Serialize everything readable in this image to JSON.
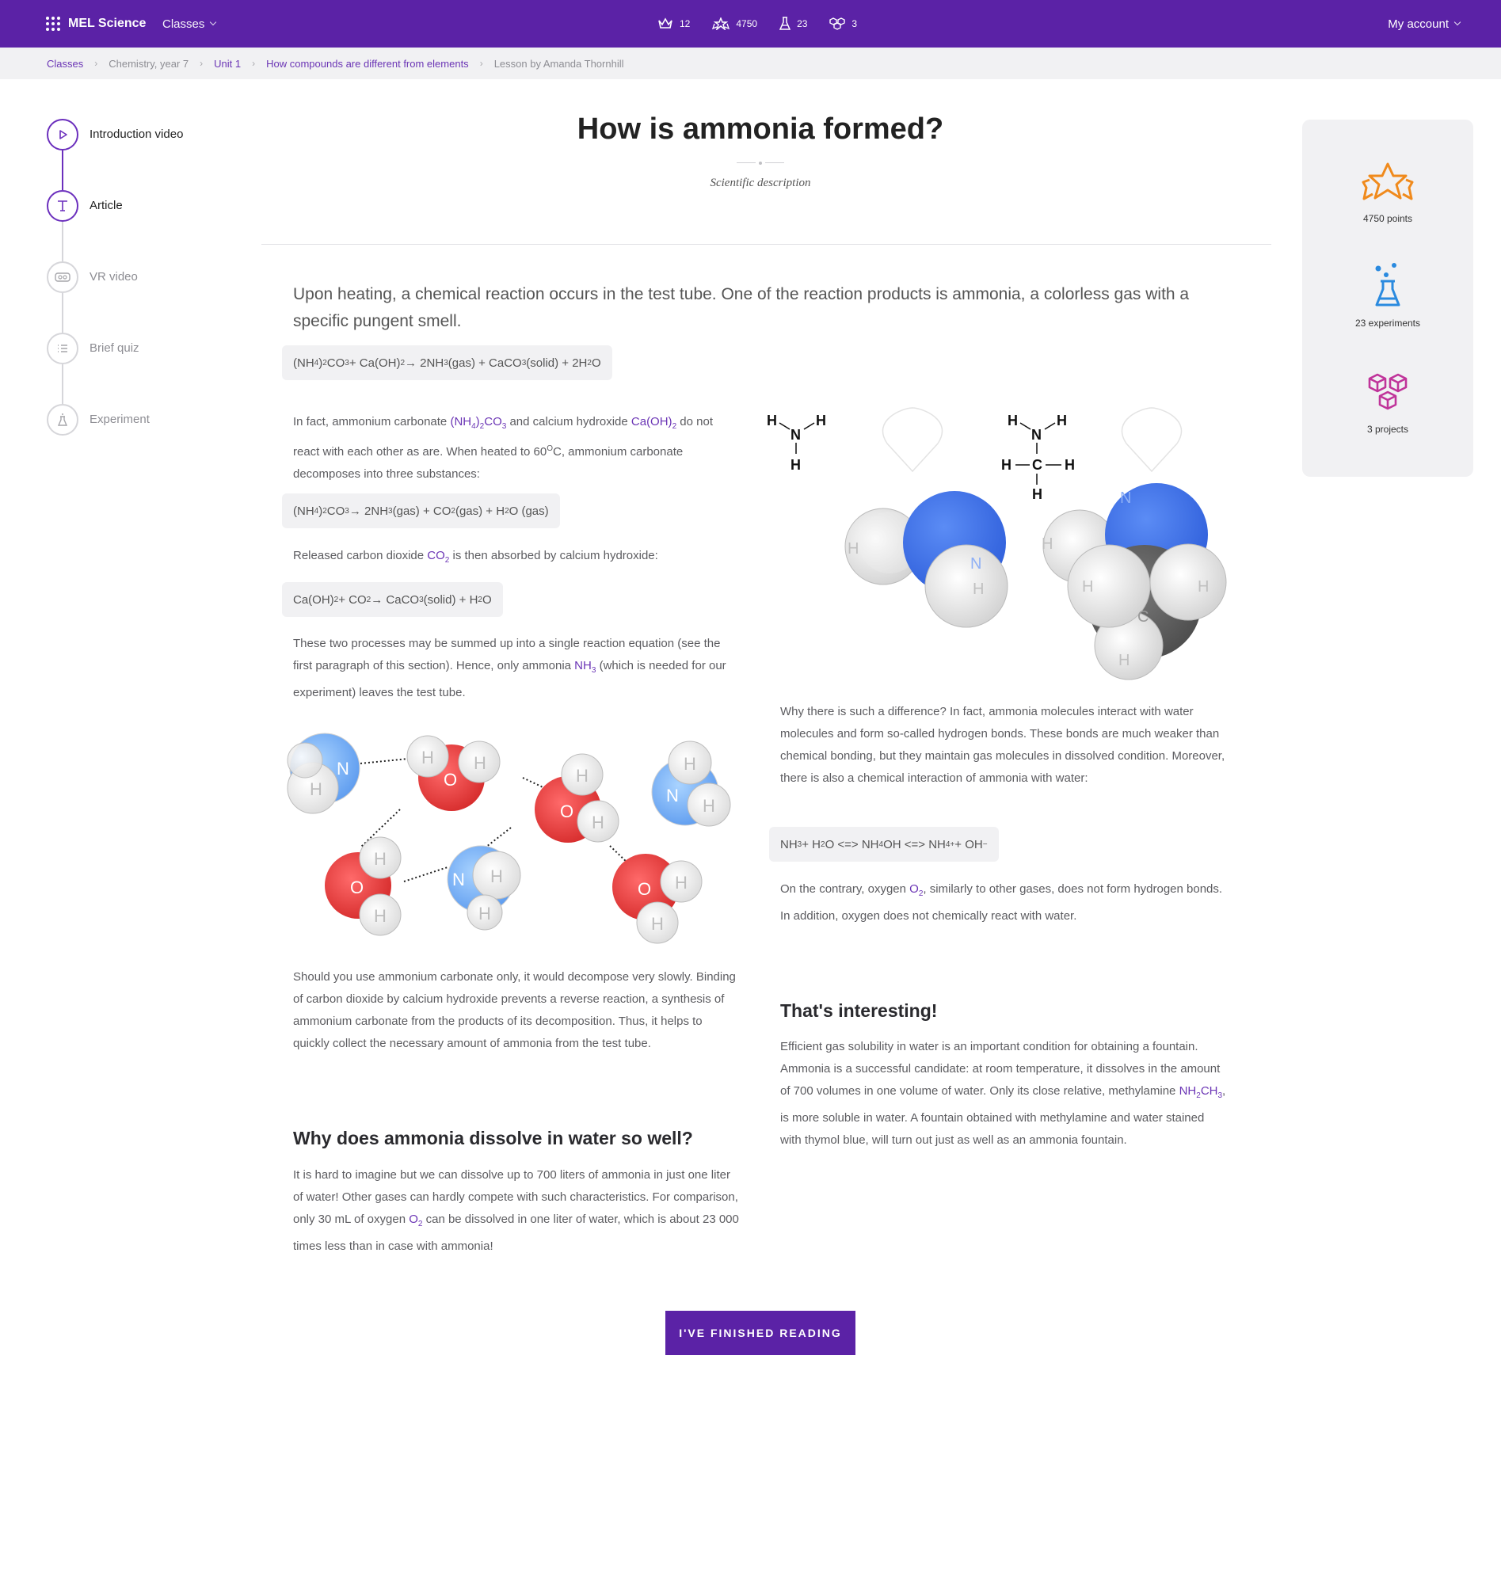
{
  "topbar": {
    "brand": "MEL Science",
    "classes_label": "Classes",
    "stats": [
      {
        "icon": "crown-icon",
        "value": "12"
      },
      {
        "icon": "stars-icon",
        "value": "4750"
      },
      {
        "icon": "flask-icon",
        "value": "23"
      },
      {
        "icon": "cubes-icon",
        "value": "3"
      }
    ],
    "account_label": "My account"
  },
  "breadcrumb": {
    "items": [
      "Classes",
      "Chemistry, year 7",
      "Unit 1",
      "How compounds are different from elements",
      "Lesson by Amanda Thornhill"
    ]
  },
  "steps": [
    {
      "label": "Introduction video",
      "icon": "play-icon"
    },
    {
      "label": "Article",
      "icon": "text-icon"
    },
    {
      "label": "VR video",
      "icon": "vr-icon"
    },
    {
      "label": "Brief quiz",
      "icon": "list-icon"
    },
    {
      "label": "Experiment",
      "icon": "flask-icon"
    }
  ],
  "article": {
    "title": "How is ammonia formed?",
    "subtitle": "Scientific description",
    "lead": "Upon heating, a chemical reaction occurs in the test tube. One of the reaction products is ammonia, a colorless gas with a specific pungent smell.",
    "p1_a": "In fact, ammonium carbonate ",
    "p1_b": " and calcium hydroxide ",
    "p1_c": " do not react with each other as are. When heated to 60",
    "p1_d": "C, ammonium carbonate decomposes into three substances:",
    "deg": "O",
    "p2_a": "Released carbon dioxide ",
    "p2_b": " is then absorbed by calcium hydroxide:",
    "p3_a": "These two processes may be summed up into a single reaction equation (see the first paragraph of this section). Hence, only ammonia ",
    "p3_b": " (which is needed for our experiment) leaves the test tube.",
    "p4": "Should you use ammonium carbonate only, it would decompose very slowly. Binding of carbon dioxide by calcium hydroxide prevents a reverse reaction, a synthesis of ammonium carbonate from the products of its decomposition. Thus, it helps to quickly collect the necessary amount of ammonia from the test tube.",
    "h_dissolve": "Why does ammonia dissolve in water so well?",
    "p5_a": "It is hard to imagine but we can dissolve up to 700 liters of ammonia in just one liter of water! Other gases can hardly compete with such characteristics. For comparison, only 30 mL of oxygen ",
    "p5_b": " can be dissolved in one liter of water, which is about 23 000 times less than in case with ammonia!",
    "p6": "Why there is such a difference? In fact, ammonia molecules interact with water molecules and form so-called hydrogen bonds. These bonds are much weaker than chemical bonding, but they maintain gas molecules in dissolved condition. Moreover, there is also a chemical interaction of ammonia with water:",
    "p7_a": "On the contrary, oxygen ",
    "p7_b": ", similarly to other gases, does not form hydrogen bonds. In addition, oxygen does not chemically react with water.",
    "h_interesting": "That's interesting!",
    "p8_a": "Efficient gas solubility in water is an important condition for obtaining a fountain. Ammonia is a successful candidate: at room temperature, it dissolves in the amount of 700 volumes in one volume of water. Only its close relative, methylamine ",
    "p8_b": ", is more soluble in water. A fountain obtained with methylamine and water stained with thymol blue, will turn out just as well as an ammonia fountain.",
    "finish_button": "I'VE FINISHED READING"
  },
  "chem": {
    "nh4": "NH",
    "co3": "CO",
    "caoh": "Ca(OH)",
    "co2": "CO",
    "nh3": "NH",
    "o2": "O",
    "nh2ch3_a": "NH",
    "nh2ch3_b": "CH",
    "sub2": "2",
    "sub3": "3",
    "sub4": "4",
    "paren_open": "(",
    "paren_close": ")"
  },
  "formulas": {
    "f1": [
      "(NH",
      "4",
      ")",
      "2",
      "CO",
      "3",
      " + Ca(OH)",
      "2",
      " → 2NH",
      "3",
      " (gas) + CaCO",
      "3",
      " (solid) + 2H",
      "2",
      "O"
    ],
    "f2": [
      "(NH",
      "4",
      ")",
      "2",
      "CO",
      "3",
      " → 2NH",
      "3",
      " (gas) + CO",
      "2",
      " (gas) + H",
      "2",
      "O (gas)"
    ],
    "f3": [
      "Ca(OH)",
      "2",
      " + CO",
      "2",
      " → CaCO",
      "3",
      " (solid) + H",
      "2",
      "O"
    ],
    "f4_a": "NH",
    "f4_b": "3",
    "f4_c": " + H",
    "f4_d": "2",
    "f4_e": "O <=> NH",
    "f4_f": "4",
    "f4_g": "OH <=> NH",
    "f4_h": "4",
    "f4_i": "+",
    "f4_j": " + OH",
    "f4_k": "−"
  },
  "molecule_labels": {
    "n": "N",
    "h": "H",
    "o": "O",
    "c": "C"
  },
  "sidebar": {
    "points": "4750 points",
    "experiments": "23 experiments",
    "projects": "3 projects"
  },
  "colors": {
    "brand": "#5b22a6",
    "link": "#6b35b5",
    "nitrogen": "#3d6ee6",
    "oxygen": "#e83f3f",
    "carbon": "#6a6a6a",
    "hydrogen": "#ffffff",
    "star": "#f08a1c",
    "flask": "#2a8adf",
    "cubes": "#c0349a"
  }
}
